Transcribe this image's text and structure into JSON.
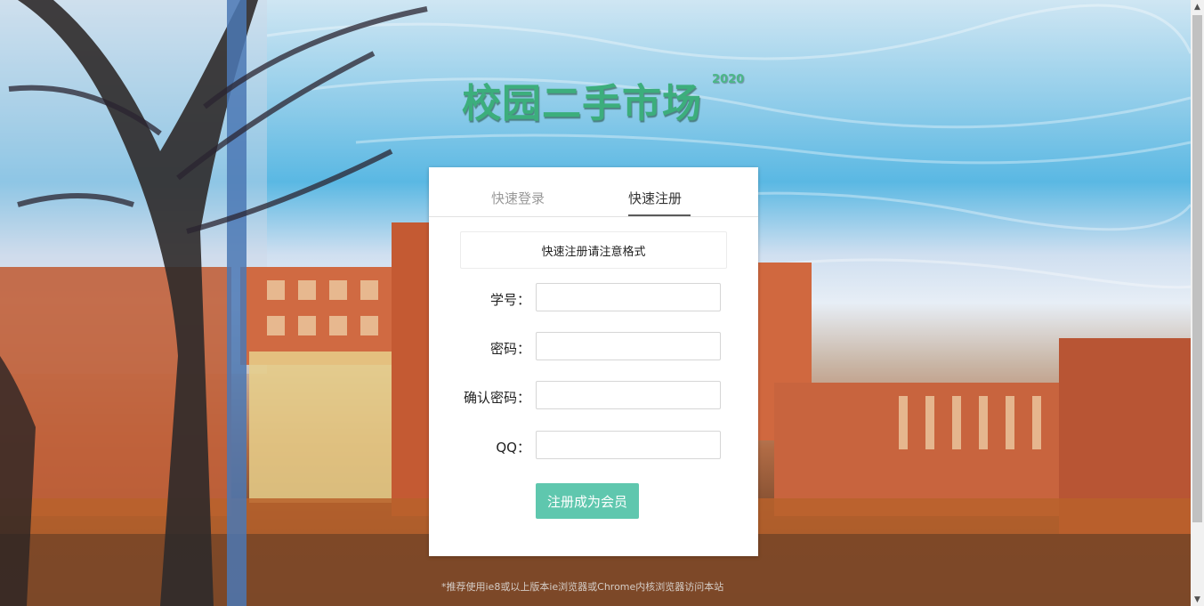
{
  "site": {
    "title": "校园二手市场",
    "year": "2020"
  },
  "tabs": [
    {
      "label": "快速登录",
      "active": false
    },
    {
      "label": "快速注册",
      "active": true
    }
  ],
  "register": {
    "notice": "快速注册请注意格式",
    "fields": [
      {
        "label": "学号：",
        "value": ""
      },
      {
        "label": "密码：",
        "value": ""
      },
      {
        "label": "确认密码：",
        "value": ""
      },
      {
        "label": "QQ：",
        "value": ""
      }
    ],
    "submit_label": "注册成为会员"
  },
  "footer": {
    "note": "*推荐使用ie8或以上版本ie浏览器或Chrome内核浏览器访问本站"
  },
  "colors": {
    "title": "#3cae7c",
    "button": "#5fc7ae",
    "active_tab_underline": "#5b5b5b"
  },
  "icons": {
    "scroll_up": "chevron-up-icon",
    "scroll_down": "chevron-down-icon"
  }
}
